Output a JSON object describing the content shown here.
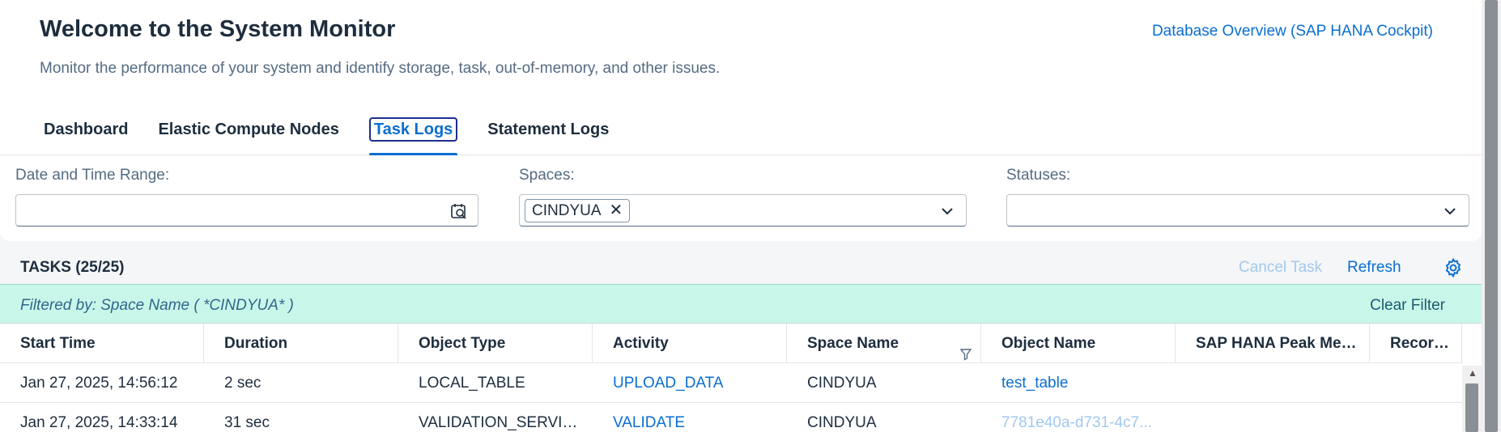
{
  "header": {
    "title": "Welcome to the System Monitor",
    "subtitle": "Monitor the performance of your system and identify storage, task, out-of-memory, and other issues.",
    "db_link": "Database Overview (SAP HANA Cockpit)"
  },
  "tabs": [
    {
      "label": "Dashboard",
      "active": false
    },
    {
      "label": "Elastic Compute Nodes",
      "active": false
    },
    {
      "label": "Task Logs",
      "active": true
    },
    {
      "label": "Statement Logs",
      "active": false
    }
  ],
  "filters": {
    "date_label": "Date and Time Range:",
    "date_value": "",
    "spaces_label": "Spaces:",
    "spaces_token": "CINDYUA",
    "statuses_label": "Statuses:",
    "statuses_value": ""
  },
  "tasks": {
    "title": "TASKS (25/25)",
    "cancel_label": "Cancel Task",
    "refresh_label": "Refresh",
    "filtered_by": "Filtered by: Space Name ( *CINDYUA* )",
    "clear_filter": "Clear Filter"
  },
  "table": {
    "columns": [
      "Start Time",
      "Duration",
      "Object Type",
      "Activity",
      "Space Name",
      "Object Name",
      "SAP HANA Peak Memo",
      "Records"
    ],
    "rows": [
      {
        "start": "Jan 27, 2025, 14:56:12",
        "duration": "2 sec",
        "object_type": "LOCAL_TABLE",
        "activity": "UPLOAD_DATA",
        "space": "CINDYUA",
        "object_name": "test_table",
        "peak_mem": "",
        "records": ""
      },
      {
        "start": "Jan 27, 2025, 14:33:14",
        "duration": "31 sec",
        "object_type": "VALIDATION_SERVICE",
        "activity": "VALIDATE",
        "space": "CINDYUA",
        "object_name": "7781e40a-d731-4c7...",
        "peak_mem": "",
        "records": ""
      }
    ]
  },
  "colors": {
    "accent": "#0a6ed1",
    "filter_bar": "#c8f7ea",
    "title": "#1d2d3e"
  }
}
